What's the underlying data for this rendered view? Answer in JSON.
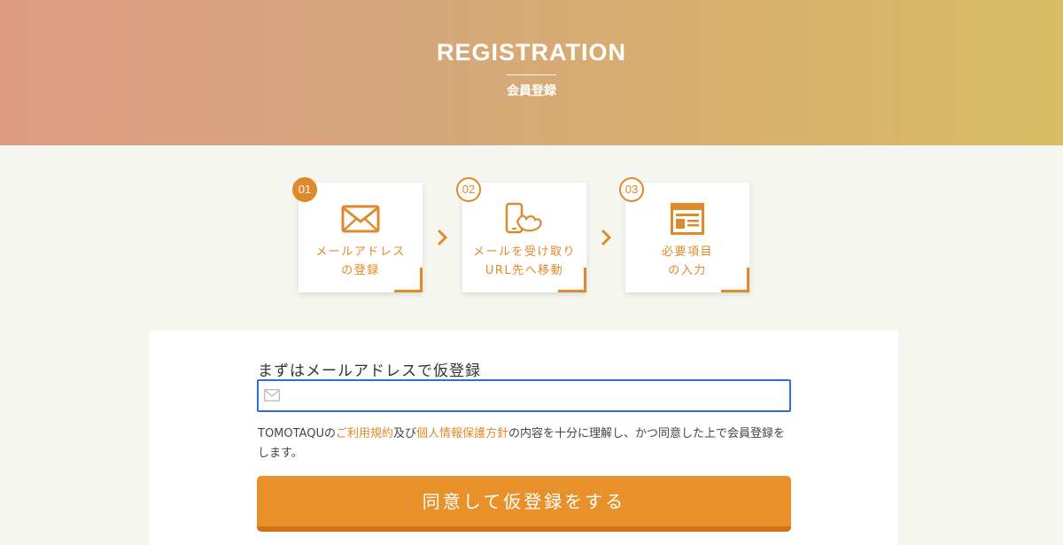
{
  "hero": {
    "title": "REGISTRATION",
    "subtitle": "会員登録"
  },
  "steps": [
    {
      "number": "01",
      "icon": "envelope-icon",
      "line1": "メールアドレス",
      "line2": "の登録",
      "active": true
    },
    {
      "number": "02",
      "icon": "phone-tap-icon",
      "line1": "メールを受け取り",
      "line2": "URL先へ移動",
      "active": false
    },
    {
      "number": "03",
      "icon": "form-document-icon",
      "line1": "必要項目",
      "line2": "の入力",
      "active": false
    }
  ],
  "form": {
    "label": "まずはメールアドレスで仮登録",
    "email_value": "",
    "email_placeholder": ""
  },
  "terms": {
    "prefix": "TOMOTAQUの",
    "terms_link": "ご利用規約",
    "middle": "及び",
    "privacy_link": "個人情報保護方針",
    "suffix": "の内容を十分に理解し、かつ同意した上で会員登録をします。"
  },
  "submit_label": "同意して仮登録をする",
  "colors": {
    "accent": "#e0892a",
    "button": "#e8902a",
    "input_focus": "#2f6fd0"
  }
}
